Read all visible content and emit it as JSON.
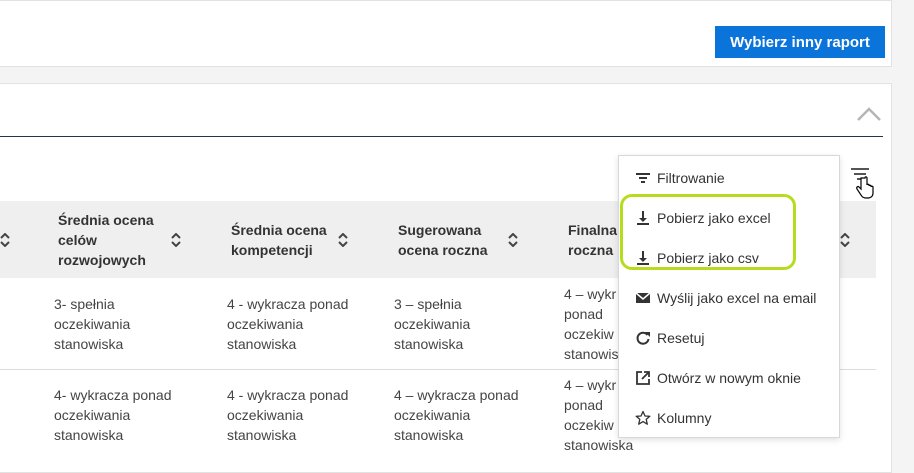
{
  "top_card": {
    "choose_report_label": "Wybierz inny raport"
  },
  "table": {
    "headers": [
      "Średnia ocena celów rozwojowych",
      "Średnia ocena kompetencji",
      "Sugerowana ocena roczna",
      "Finalna ocena roczna"
    ],
    "header_lines": [
      [
        "Średnia ocena",
        "celów",
        "rozwojowych"
      ],
      [
        "Średnia ocena",
        "kompetencji"
      ],
      [
        "Sugerowana",
        "ocena roczna"
      ],
      [
        "Finalna",
        "roczna"
      ]
    ],
    "rows": [
      [
        [
          "3- spełnia",
          "oczekiwania",
          "stanowiska"
        ],
        [
          "4 - wykracza ponad",
          "oczekiwania",
          "stanowiska"
        ],
        [
          "3 – spełnia",
          "oczekiwania",
          "stanowiska"
        ],
        [
          "4 – wykr",
          "ponad",
          "oczekiw",
          "stanowiska"
        ]
      ],
      [
        [
          "4- wykracza ponad",
          "oczekiwania",
          "stanowiska"
        ],
        [
          "4 - wykracza ponad",
          "oczekiwania",
          "stanowiska"
        ],
        [
          "4 – wykracza ponad",
          "oczekiwania",
          "stanowiska"
        ],
        [
          "4 – wykr",
          "ponad",
          "oczekiw",
          "stanowiska"
        ]
      ]
    ]
  },
  "menu": {
    "items": [
      {
        "label": "Filtrowanie",
        "icon": "filter-icon"
      },
      {
        "label": "Pobierz jako excel",
        "icon": "download-icon"
      },
      {
        "label": "Pobierz jako csv",
        "icon": "download-icon"
      },
      {
        "label": "Wyślij jako excel na email",
        "icon": "email-icon"
      },
      {
        "label": "Resetuj",
        "icon": "reset-icon"
      },
      {
        "label": "Otwórz w nowym oknie",
        "icon": "external-link-icon"
      },
      {
        "label": "Kolumny",
        "icon": "star-icon"
      }
    ]
  },
  "colors": {
    "primary": "#0a74da",
    "highlight": "#b5dd1e",
    "divider": "#1f3550",
    "header_bg": "#efefef"
  }
}
